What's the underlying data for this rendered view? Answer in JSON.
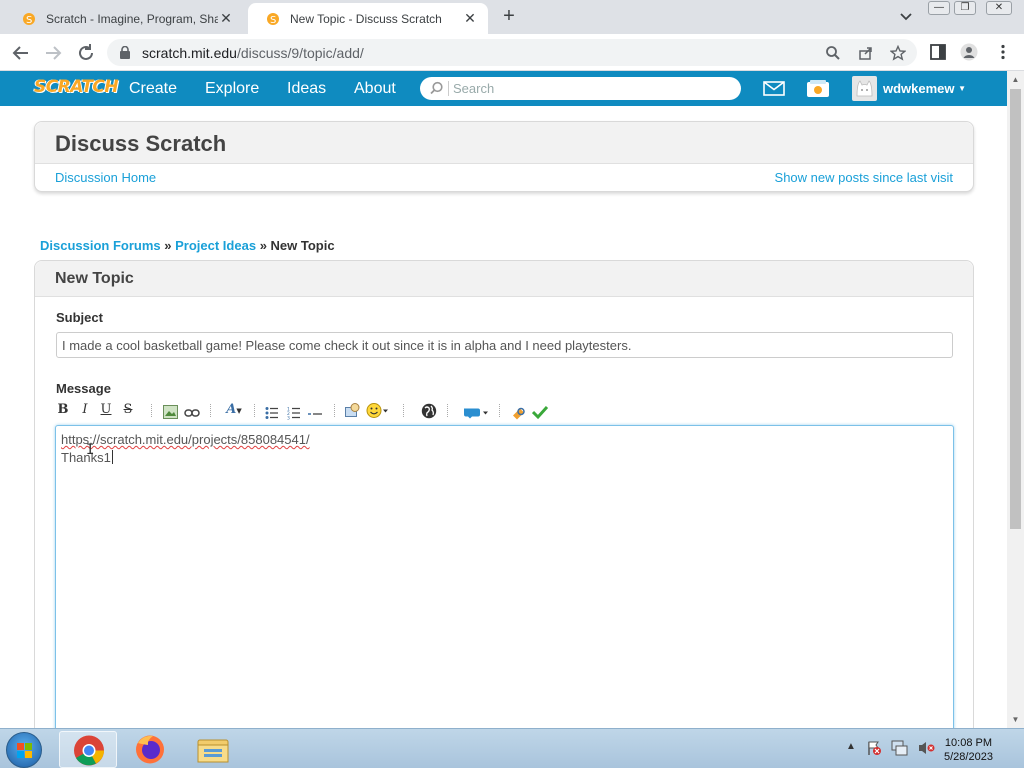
{
  "browser": {
    "tabs": [
      {
        "title": "Scratch - Imagine, Program, Share",
        "active": false
      },
      {
        "title": "New Topic - Discuss Scratch",
        "active": true
      }
    ],
    "url_host": "scratch.mit.edu",
    "url_path": "/discuss/9/topic/add/"
  },
  "scratch_nav": {
    "logo": "SCRATCH",
    "links": [
      "Create",
      "Explore",
      "Ideas",
      "About"
    ],
    "search_placeholder": "Search",
    "username": "wdwkemew"
  },
  "discuss": {
    "title": "Discuss Scratch",
    "home_link": "Discussion Home",
    "new_posts_link": "Show new posts since last visit"
  },
  "breadcrumb": {
    "forums": "Discussion Forums",
    "sep": "»",
    "category": "Project Ideas",
    "current": "New Topic"
  },
  "form": {
    "title": "New Topic",
    "subject_label": "Subject",
    "subject_value": "I made a cool basketball game! Please come check it out since it is in alpha and I need playtesters.",
    "message_label": "Message",
    "message_line1": "https://scratch.mit.edu/projects/858084541/",
    "message_line2": "Thanks1"
  },
  "taskbar": {
    "time": "10:08 PM",
    "date": "5/28/2023"
  },
  "colors": {
    "scratch_blue": "#0f8bc0",
    "link_blue": "#1aa0d8"
  }
}
